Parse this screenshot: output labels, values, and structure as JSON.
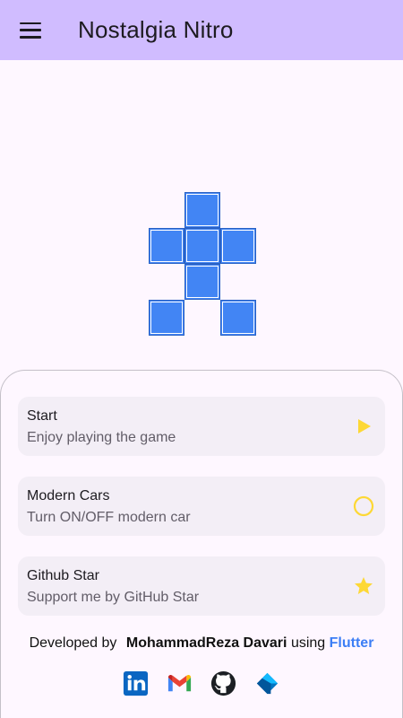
{
  "appbar": {
    "title": "Nostalgia Nitro",
    "menu_icon": "hamburger-menu-icon"
  },
  "menu": {
    "items": [
      {
        "title": "Start",
        "subtitle": "Enjoy playing the game",
        "icon": "play-icon",
        "icon_color": "#fdd835"
      },
      {
        "title": "Modern Cars",
        "subtitle": "Turn ON/OFF modern car",
        "icon": "circle-outline-icon",
        "icon_color": "#fdd835"
      },
      {
        "title": "Github Star",
        "subtitle": "Support me by GitHub Star",
        "icon": "star-icon",
        "icon_color": "#fdd835"
      }
    ]
  },
  "credit": {
    "prefix": "Developed by",
    "author": "MohammadReza Davari",
    "middle": "using",
    "framework": "Flutter",
    "framework_color": "#3c7ef5"
  },
  "socials": [
    "linkedin-icon",
    "gmail-icon",
    "github-icon",
    "dart-icon"
  ],
  "colors": {
    "appbar": "#d0bcff",
    "car_block": "#4285f4",
    "background": "#fef7ff"
  }
}
